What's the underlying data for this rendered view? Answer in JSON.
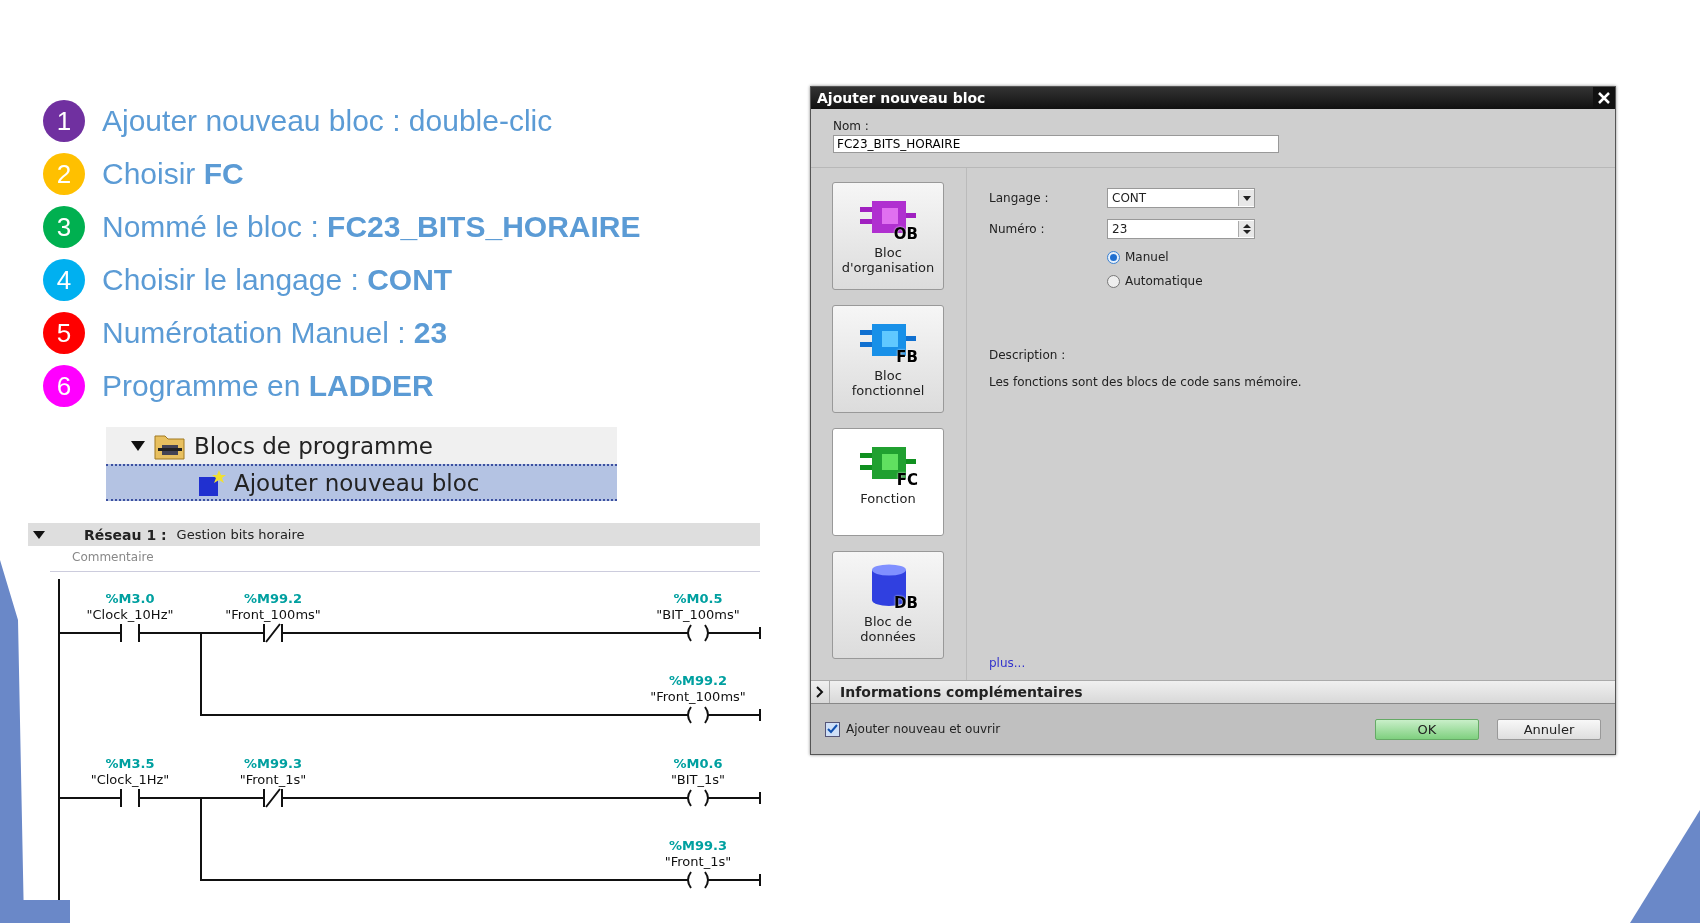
{
  "steps": [
    {
      "number": "1",
      "color": "#7030a0",
      "text": "Ajouter nouveau bloc : double-clic"
    },
    {
      "number": "2",
      "color": "#ffc000",
      "text": "Choisir **FC**"
    },
    {
      "number": "3",
      "color": "#00b050",
      "text": "Nommé le bloc : **FC23_BITS_HORAIRE**"
    },
    {
      "number": "4",
      "color": "#00b0f0",
      "text": "Choisir le langage : **CONT**"
    },
    {
      "number": "5",
      "color": "#ff0000",
      "text": "Numérotation Manuel : **23**"
    },
    {
      "number": "6",
      "color": "#ff00ff",
      "text": "Programme en **LADDER**"
    }
  ],
  "project_tree": {
    "folder": {
      "label": "Blocs de programme",
      "expanded": true
    },
    "items": [
      {
        "label": "Ajouter nouveau bloc",
        "selected": true
      }
    ]
  },
  "network": {
    "title": "Réseau 1 :",
    "subtitle": "Gestion bits horaire",
    "expanded": true,
    "comment": "Commentaire",
    "rungs": [
      {
        "contacts": [
          {
            "kind": "no",
            "address": "%M3.0",
            "tag": "\"Clock_10Hz\""
          },
          {
            "kind": "nc",
            "address": "%M99.2",
            "tag": "\"Front_100ms\""
          }
        ],
        "coil": {
          "address": "%M0.5",
          "tag": "\"BIT_100ms\""
        },
        "parallel_coil": {
          "address": "%M99.2",
          "tag": "\"Front_100ms\""
        }
      },
      {
        "contacts": [
          {
            "kind": "no",
            "address": "%M3.5",
            "tag": "\"Clock_1Hz\""
          },
          {
            "kind": "nc",
            "address": "%M99.3",
            "tag": "\"Front_1s\""
          }
        ],
        "coil": {
          "address": "%M0.6",
          "tag": "\"BIT_1s\""
        },
        "parallel_coil": {
          "address": "%M99.3",
          "tag": "\"Front_1s\""
        }
      }
    ]
  },
  "dialog": {
    "title": "Ajouter nouveau bloc",
    "name_label": "Nom :",
    "name_value": "FC23_BITS_HORAIRE",
    "block_types": [
      {
        "label": "Bloc d'organisation",
        "badge": "OB",
        "kind": "ob",
        "selected": false
      },
      {
        "label": "Bloc fonctionnel",
        "badge": "FB",
        "kind": "fb",
        "selected": false
      },
      {
        "label": "Fonction",
        "badge": "FC",
        "kind": "fc",
        "selected": true
      },
      {
        "label": "Bloc de données",
        "badge": "DB",
        "kind": "db",
        "selected": false
      }
    ],
    "language": {
      "label": "Langage :",
      "value": "CONT"
    },
    "number": {
      "label": "Numéro :",
      "value": "23"
    },
    "numbering": [
      {
        "label": "Manuel",
        "selected": true
      },
      {
        "label": "Automatique",
        "selected": false
      }
    ],
    "description_label": "Description :",
    "description": "Les fonctions sont des blocs de code sans mémoire.",
    "more_link": "plus...",
    "more_info": {
      "label": "Informations complémentaires",
      "expanded": false
    },
    "open_after": {
      "label": "Ajouter nouveau et ouvrir",
      "checked": true
    },
    "buttons": [
      {
        "label": "OK",
        "kind": "primary"
      },
      {
        "label": "Annuler",
        "kind": "secondary"
      }
    ]
  }
}
